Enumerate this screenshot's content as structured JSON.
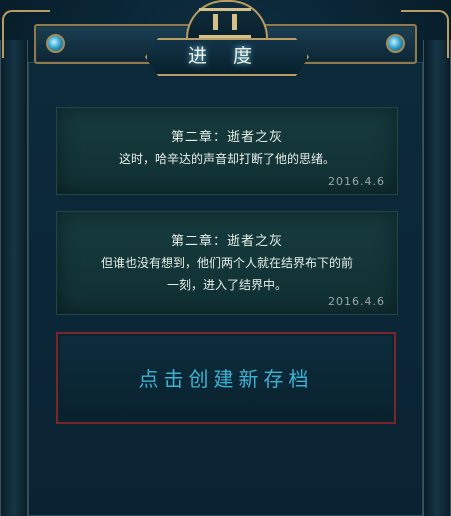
{
  "header": {
    "title": "进 度"
  },
  "saves": [
    {
      "title": "第二章：逝者之灰",
      "lines": [
        "这时，哈辛达的声音却打断了他的思绪。"
      ],
      "date": "2016.4.6"
    },
    {
      "title": "第二章：逝者之灰",
      "lines": [
        "但谁也没有想到，他们两个人就在结界布下的前",
        "一刻，进入了结界中。"
      ],
      "date": "2016.4.6"
    }
  ],
  "actions": {
    "new_save_label": "点击创建新存档"
  },
  "colors": {
    "accent": "#39b3d2",
    "frame_gold": "#b79c64",
    "button_red": "#7a252a"
  },
  "icons": [
    "crest-icon",
    "gem-icon"
  ]
}
